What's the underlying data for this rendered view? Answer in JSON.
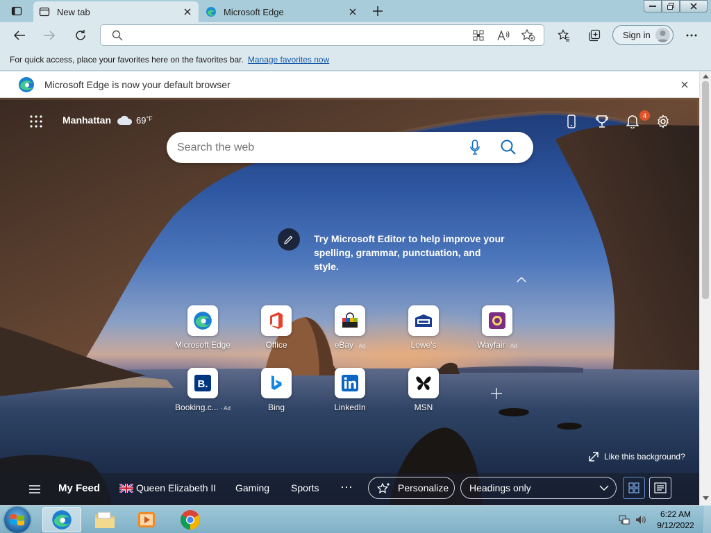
{
  "tabs": [
    {
      "title": "New tab",
      "active": true
    },
    {
      "title": "Microsoft Edge",
      "active": false
    }
  ],
  "address": {
    "value": "",
    "placeholder": ""
  },
  "toolbar": {
    "signin_label": "Sign in"
  },
  "favorites_bar": {
    "message": "For quick access, place your favorites here on the favorites bar.",
    "link": "Manage favorites now"
  },
  "infobar": {
    "message": "Microsoft Edge is now your default browser"
  },
  "ntp": {
    "weather": {
      "location": "Manhattan",
      "temp": "69",
      "unit": "°F"
    },
    "notifications_count": "4",
    "search": {
      "placeholder": "Search the web"
    },
    "editor_tip": "Try Microsoft Editor to help improve your spelling, grammar, punctuation, and style.",
    "quick_links": [
      {
        "label": "Microsoft Edge",
        "ad": "",
        "icon": "edge-icon"
      },
      {
        "label": "Office",
        "ad": "",
        "icon": "office-icon"
      },
      {
        "label": "eBay",
        "ad": "· Ad",
        "icon": "ebay-icon"
      },
      {
        "label": "Lowe's",
        "ad": "",
        "icon": "lowes-icon"
      },
      {
        "label": "Wayfair",
        "ad": "· Ad",
        "icon": "wayfair-icon"
      },
      {
        "label": "Booking.c...",
        "ad": "· Ad",
        "icon": "booking-icon"
      },
      {
        "label": "Bing",
        "ad": "",
        "icon": "bing-icon"
      },
      {
        "label": "LinkedIn",
        "ad": "",
        "icon": "linkedin-icon"
      },
      {
        "label": "MSN",
        "ad": "",
        "icon": "msn-icon"
      }
    ],
    "like_background": "Like this background?",
    "feed": {
      "my_feed": "My Feed",
      "tabs": [
        "Queen Elizabeth II",
        "Gaming",
        "Sports"
      ],
      "more": "···",
      "personalize": "Personalize",
      "headings": "Headings only"
    }
  },
  "taskbar": {
    "time": "6:22 AM",
    "date": "9/12/2022"
  },
  "colors": {
    "accent": "#0f6cbd",
    "tabbar": "#a8ccd9",
    "toolbar": "#dbe8ee",
    "badge": "#e0542b"
  }
}
